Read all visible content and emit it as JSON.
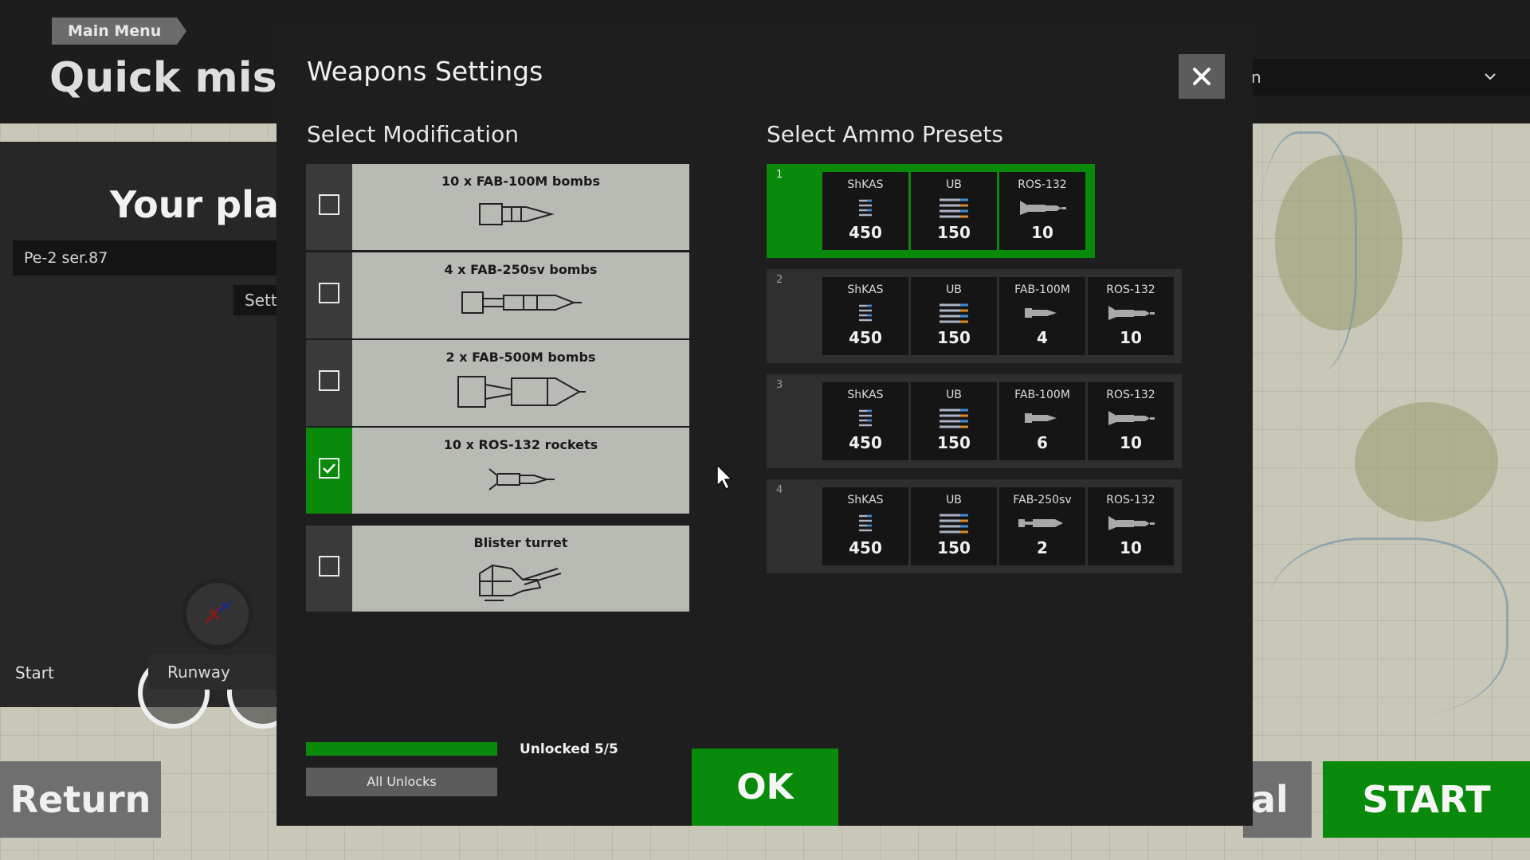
{
  "background": {
    "breadcrumb": "Main Menu",
    "title": "Quick missi",
    "plane_title": "Your plane",
    "plane_value": "Pe-2 ser.87",
    "settings_label": "Sett",
    "start_label": "Start",
    "runway_label": "Runway",
    "dropdown_partial": "n",
    "return_label": "Return",
    "partial_button_label": "al",
    "start_button_label": "START"
  },
  "dialog": {
    "title": "Weapons Settings",
    "close_icon": "close-icon",
    "modification_heading": "Select Modification",
    "presets_heading": "Select Ammo Presets",
    "modifications": [
      {
        "label": "10 x FAB-100M bombs",
        "checked": false,
        "icon": "bomb-small-icon"
      },
      {
        "label": "4 x FAB-250sv bombs",
        "checked": false,
        "icon": "bomb-long-icon"
      },
      {
        "label": "2 x FAB-500M bombs",
        "checked": false,
        "icon": "bomb-large-icon"
      },
      {
        "label": "10 x ROS-132 rockets",
        "checked": true,
        "icon": "rocket-icon"
      },
      {
        "label": "Blister turret",
        "checked": false,
        "icon": "turret-icon"
      }
    ],
    "presets": [
      {
        "number": "1",
        "selected": true,
        "slots": [
          {
            "name": "ShKAS",
            "count": "450",
            "icon": "ammo-belt-icon"
          },
          {
            "name": "UB",
            "count": "150",
            "icon": "ammo-belt-large-icon"
          },
          {
            "name": "ROS-132",
            "count": "10",
            "icon": "rocket-icon"
          }
        ]
      },
      {
        "number": "2",
        "selected": false,
        "slots": [
          {
            "name": "ShKAS",
            "count": "450",
            "icon": "ammo-belt-icon"
          },
          {
            "name": "UB",
            "count": "150",
            "icon": "ammo-belt-large-icon"
          },
          {
            "name": "FAB-100M",
            "count": "4",
            "icon": "bomb-icon"
          },
          {
            "name": "ROS-132",
            "count": "10",
            "icon": "rocket-icon"
          }
        ]
      },
      {
        "number": "3",
        "selected": false,
        "slots": [
          {
            "name": "ShKAS",
            "count": "450",
            "icon": "ammo-belt-icon"
          },
          {
            "name": "UB",
            "count": "150",
            "icon": "ammo-belt-large-icon"
          },
          {
            "name": "FAB-100M",
            "count": "6",
            "icon": "bomb-icon"
          },
          {
            "name": "ROS-132",
            "count": "10",
            "icon": "rocket-icon"
          }
        ]
      },
      {
        "number": "4",
        "selected": false,
        "slots": [
          {
            "name": "ShKAS",
            "count": "450",
            "icon": "ammo-belt-icon"
          },
          {
            "name": "UB",
            "count": "150",
            "icon": "ammo-belt-large-icon"
          },
          {
            "name": "FAB-250sv",
            "count": "2",
            "icon": "bomb-long-icon"
          },
          {
            "name": "ROS-132",
            "count": "10",
            "icon": "rocket-icon"
          }
        ]
      }
    ],
    "unlock_progress": 1.0,
    "unlocked_label": "Unlocked 5/5",
    "all_unlocks_label": "All Unlocks",
    "ok_label": "OK"
  },
  "colors": {
    "accent_green": "#0a8a0a",
    "dialog_bg": "#1e1e1e",
    "mod_card_bg": "#b7bbb4"
  }
}
